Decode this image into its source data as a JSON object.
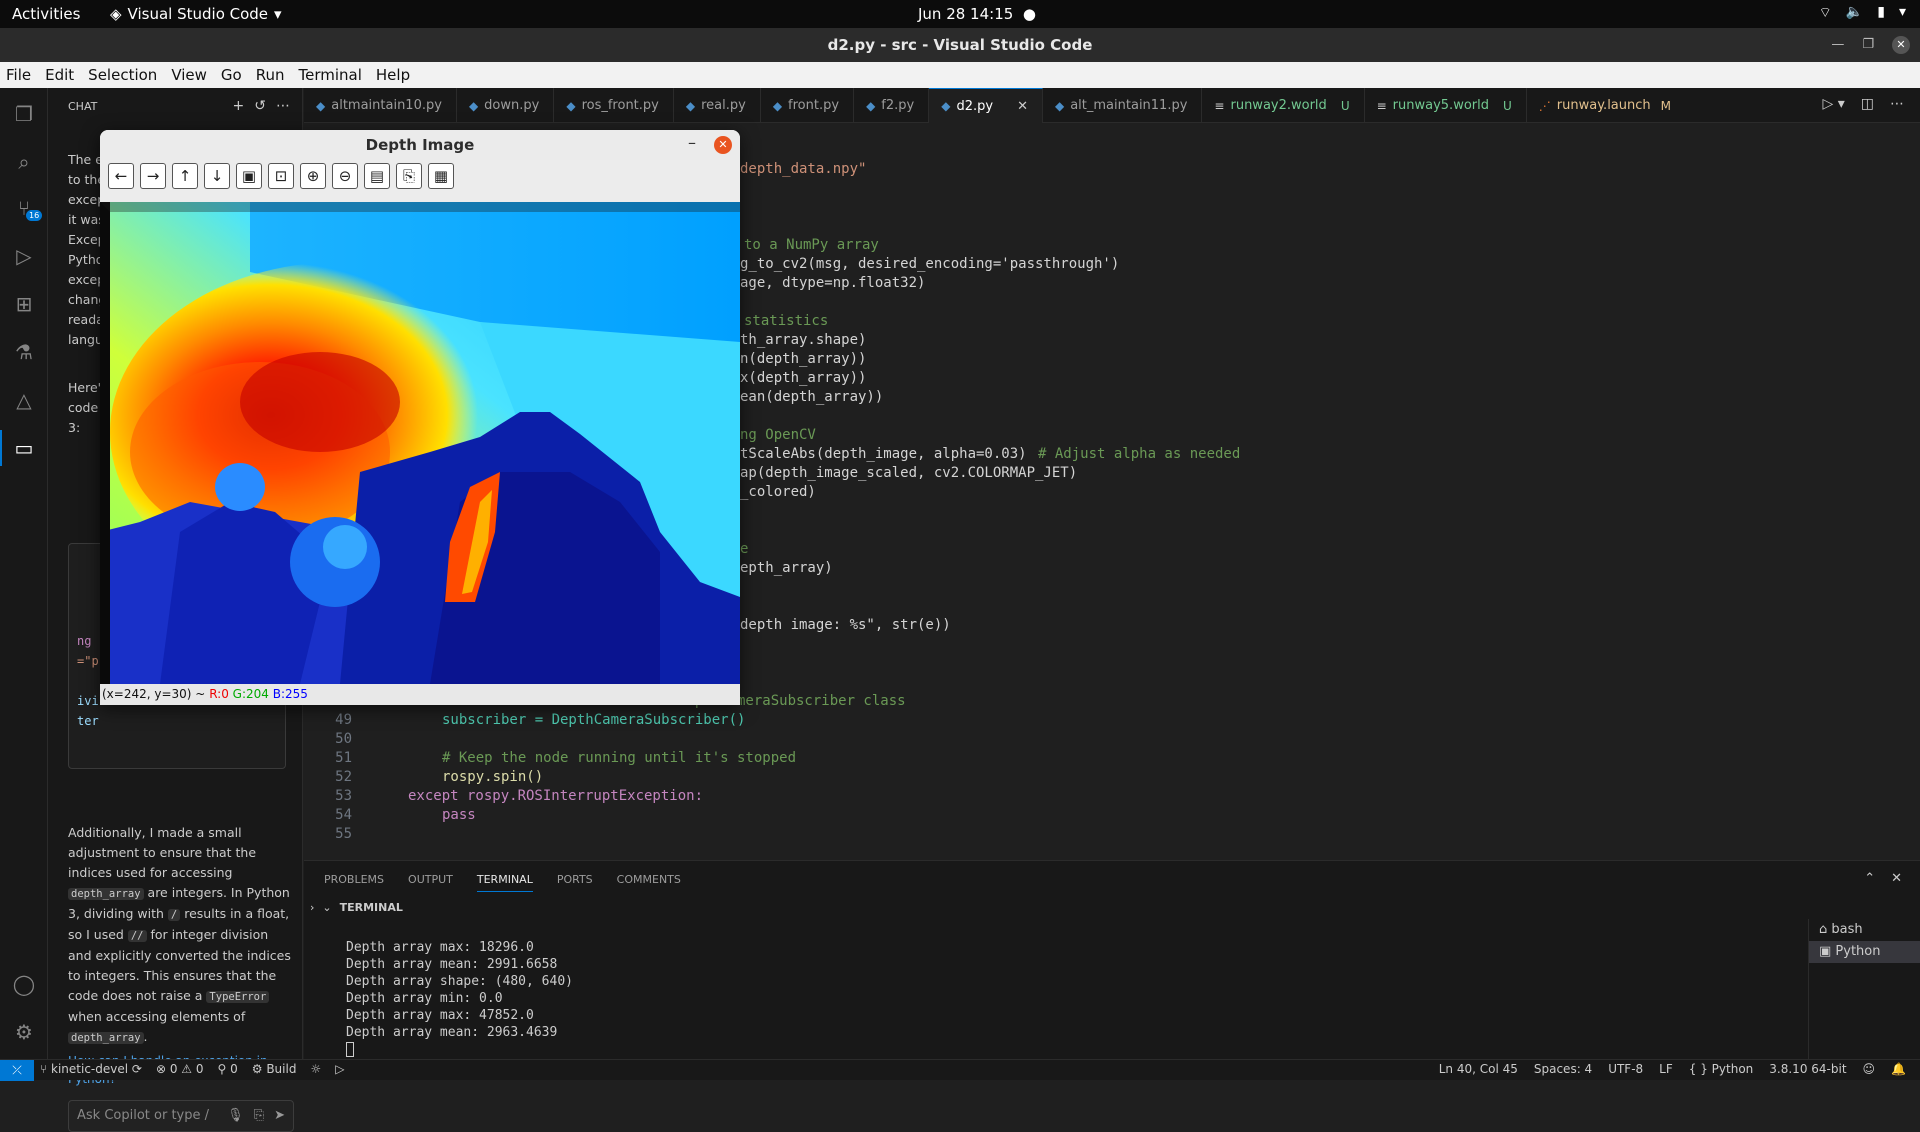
{
  "system_bar": {
    "activities": "Activities",
    "app": "Visual Studio Code",
    "clock": "Jun 28  14:15"
  },
  "window": {
    "title": "d2.py - src - Visual Studio Code"
  },
  "menu": [
    "File",
    "Edit",
    "Selection",
    "View",
    "Go",
    "Run",
    "Terminal",
    "Help"
  ],
  "activity_bar": {
    "scm_badge": "16"
  },
  "chat": {
    "header": "CHAT",
    "fragments": [
      "The e",
      "to the",
      "excep",
      "it was",
      "Excep",
      "Pytho",
      "excep",
      "chang",
      "reada",
      "langu",
      "Here'",
      "code",
      "3:"
    ],
    "code_fragments": [
      "ng",
      "=\"p",
      "ivi",
      "ter"
    ],
    "para": {
      "t1": "Additionally, I made a small adjustment to ensure that the indices used for accessing",
      "c1": "depth_array",
      "t2": "are integers. In Python 3, dividing with",
      "c2": "/",
      "t3": "results in a float, so I used",
      "c3": "//",
      "t4": "for integer division and explicitly converted the indices to integers. This ensures that the code does not raise a",
      "c4": "TypeError",
      "t5": "when accessing elements of",
      "c5": "depth_array",
      "t6": "."
    },
    "suggestion": "How can I handle an exception in Python?",
    "input_placeholder": "Ask Copilot or type /"
  },
  "tabs": [
    {
      "label": "altmaintain10.py",
      "active": false
    },
    {
      "label": "down.py",
      "active": false
    },
    {
      "label": "ros_front.py",
      "active": false
    },
    {
      "label": "real.py",
      "active": false
    },
    {
      "label": "front.py",
      "active": false
    },
    {
      "label": "f2.py",
      "active": false
    },
    {
      "label": "d2.py",
      "active": true
    },
    {
      "label": "alt_maintain11.py",
      "active": false
    },
    {
      "label": "runway2.world",
      "status": "U"
    },
    {
      "label": "runway5.world",
      "status": "U"
    },
    {
      "label": "runway.launch",
      "status": "M"
    }
  ],
  "code_partial": [
    "depth_data.npy\"",
    "to a NumPy array",
    "g_to_cv2(msg, desired_encoding='passthrough')",
    "age, dtype=np.float32)",
    "statistics",
    "th_array.shape)",
    "n(depth_array))",
    "x(depth_array))",
    "ean(depth_array))",
    "ng OpenCV",
    "tScaleAbs(depth_image, alpha=0.03)",
    "# Adjust alpha as needed",
    "ap(depth_image_scaled, cv2.COLORMAP_JET)",
    "_colored)",
    "e",
    "epth_array)",
    "depth image: %s\", str(e))"
  ],
  "code_lines": [
    {
      "n": "48",
      "text": "# Create an instance of the DepthCameraSubscriber class"
    },
    {
      "n": "49",
      "text": "subscriber = DepthCameraSubscriber()"
    },
    {
      "n": "50",
      "text": ""
    },
    {
      "n": "51",
      "text": "# Keep the node running until it's stopped"
    },
    {
      "n": "52",
      "text": "rospy.spin()"
    },
    {
      "n": "53",
      "text": "except rospy.ROSInterruptException:"
    },
    {
      "n": "54",
      "text": "pass"
    },
    {
      "n": "55",
      "text": ""
    }
  ],
  "panel": {
    "tabs": [
      "PROBLEMS",
      "OUTPUT",
      "TERMINAL",
      "PORTS",
      "COMMENTS"
    ],
    "section": "TERMINAL",
    "output": [
      "Depth array max: 18296.0",
      "Depth array mean: 2991.6658",
      "Depth array shape: (480, 640)",
      "Depth array min: 0.0",
      "Depth array max: 47852.0",
      "Depth array mean: 2963.4639"
    ],
    "terminals": [
      "bash",
      "Python"
    ]
  },
  "status_bar": {
    "branch": "kinetic-devel",
    "errors": "0",
    "warnings": "0",
    "ports": "0",
    "build": "Build",
    "position": "Ln 40, Col 45",
    "spaces": "Spaces: 4",
    "encoding": "UTF-8",
    "eol": "LF",
    "language": "Python",
    "interpreter": "3.8.10 64-bit"
  },
  "depth_window": {
    "title": "Depth Image",
    "pixel_info": {
      "coords": "(x=242, y=30) ~",
      "r": "R:0",
      "g": "G:204",
      "b": "B:255"
    }
  }
}
